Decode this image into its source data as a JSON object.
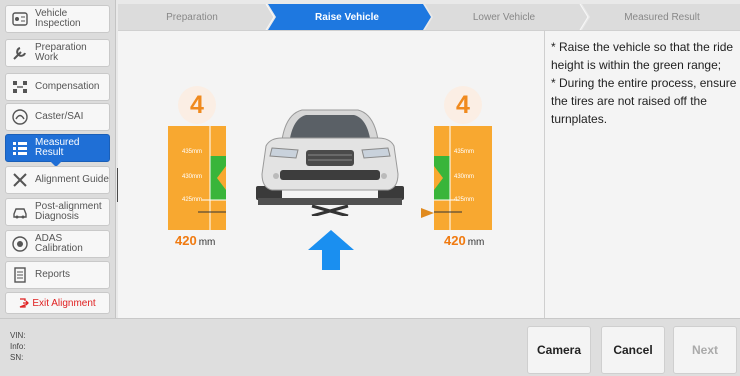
{
  "sidebar": {
    "items": [
      {
        "label": "Vehicle Inspection",
        "icon": "vehicle-inspection-icon"
      },
      {
        "label": "Preparation Work",
        "icon": "wrench-icon"
      },
      {
        "label": "Compensation",
        "icon": "compensation-icon"
      },
      {
        "label": "Caster/SAI",
        "icon": "caster-icon"
      },
      {
        "label": "Measured Result",
        "icon": "list-icon"
      },
      {
        "label": "Alignment Guide",
        "icon": "tools-icon"
      },
      {
        "label": "Post-alignment Diagnosis",
        "icon": "car-diagnosis-icon"
      },
      {
        "label": "ADAS Calibration",
        "icon": "adas-icon"
      },
      {
        "label": "Reports",
        "icon": "report-icon"
      }
    ],
    "active_index": 4,
    "exit_label": "Exit Alignment"
  },
  "steps": [
    "Preparation",
    "Raise Vehicle",
    "Lower Vehicle",
    "Measured Result"
  ],
  "active_step": 1,
  "instructions": [
    "* Raise the vehicle so that the ride height is within the green range;",
    "* During the entire process, ensure the tires are not raised off the turnplates."
  ],
  "gauges": {
    "left": {
      "count": "4",
      "reading": "420",
      "unit": "mm"
    },
    "right": {
      "count": "4",
      "reading": "420",
      "unit": "mm"
    },
    "ticks": [
      "435mm",
      "430mm",
      "425mm"
    ]
  },
  "bottom": {
    "vin_label": "VIN:",
    "info_label": "Info:",
    "sn_label": "SN:",
    "buttons": {
      "camera": "Camera",
      "cancel": "Cancel",
      "next": "Next"
    }
  },
  "colors": {
    "accent": "#1f6fd6",
    "gauge_orange": "#f8a830",
    "gauge_green": "#39b53a",
    "reading_orange": "#f07a10",
    "exit_red": "#e02020"
  }
}
